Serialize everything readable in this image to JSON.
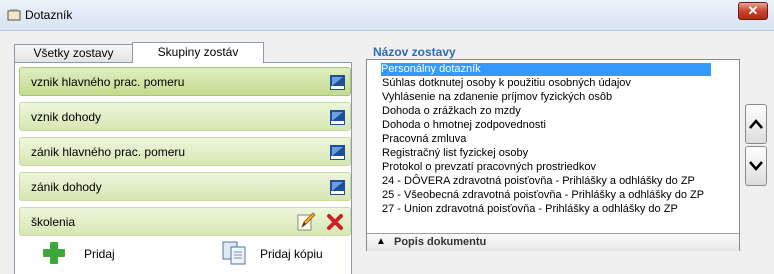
{
  "window": {
    "title": "Dotazník",
    "close_symbol": "✕"
  },
  "tabs": [
    {
      "label": "Všetky zostavy",
      "selected": false
    },
    {
      "label": "Skupiny zostáv",
      "selected": true
    }
  ],
  "groups": [
    {
      "label": "vznik hlavného prac. pomeru",
      "icon": "kros-logo-icon",
      "selected": true
    },
    {
      "label": "vznik dohody",
      "icon": "kros-logo-icon",
      "selected": false
    },
    {
      "label": "zánik hlavného prac. pomeru",
      "icon": "kros-logo-icon",
      "selected": false
    },
    {
      "label": "zánik dohody",
      "icon": "kros-logo-icon",
      "selected": false
    },
    {
      "label": "školenia",
      "icons": [
        "edit-icon",
        "delete-icon"
      ],
      "selected": false
    }
  ],
  "buttons": {
    "add": "Pridaj",
    "add_copy": "Pridaj kópiu"
  },
  "report_list": {
    "title": "Názov zostavy",
    "items": [
      "Personálny dotazník",
      "Súhlas dotknutej osoby k použitiu osobných údajov",
      "Vyhlásenie na zdanenie príjmov fyzických osôb",
      "Dohoda o zrážkach zo mzdy",
      "Dohoda o hmotnej zodpovednosti",
      "Pracovná zmluva",
      "Registračný list fyzickej osoby",
      "Protokol o prevzatí pracovných prostriedkov",
      "24 - DÔVERA zdravotná poisťovňa - Prihlášky a odhlášky do ZP",
      "25 - Všeobecná zdravotná poisťovňa - Prihlášky a odhlášky do ZP",
      "27 - Union zdravotná poisťovňa - Prihlášky a odhlášky do ZP"
    ],
    "selected_index": 0,
    "footer_label": "Popis dokumentu"
  },
  "colors": {
    "accent": "#2c6bb8",
    "selection": "#3399ff",
    "group_bg": "#d6e7b3",
    "delete": "#cc2222",
    "add": "#3ca83c"
  }
}
